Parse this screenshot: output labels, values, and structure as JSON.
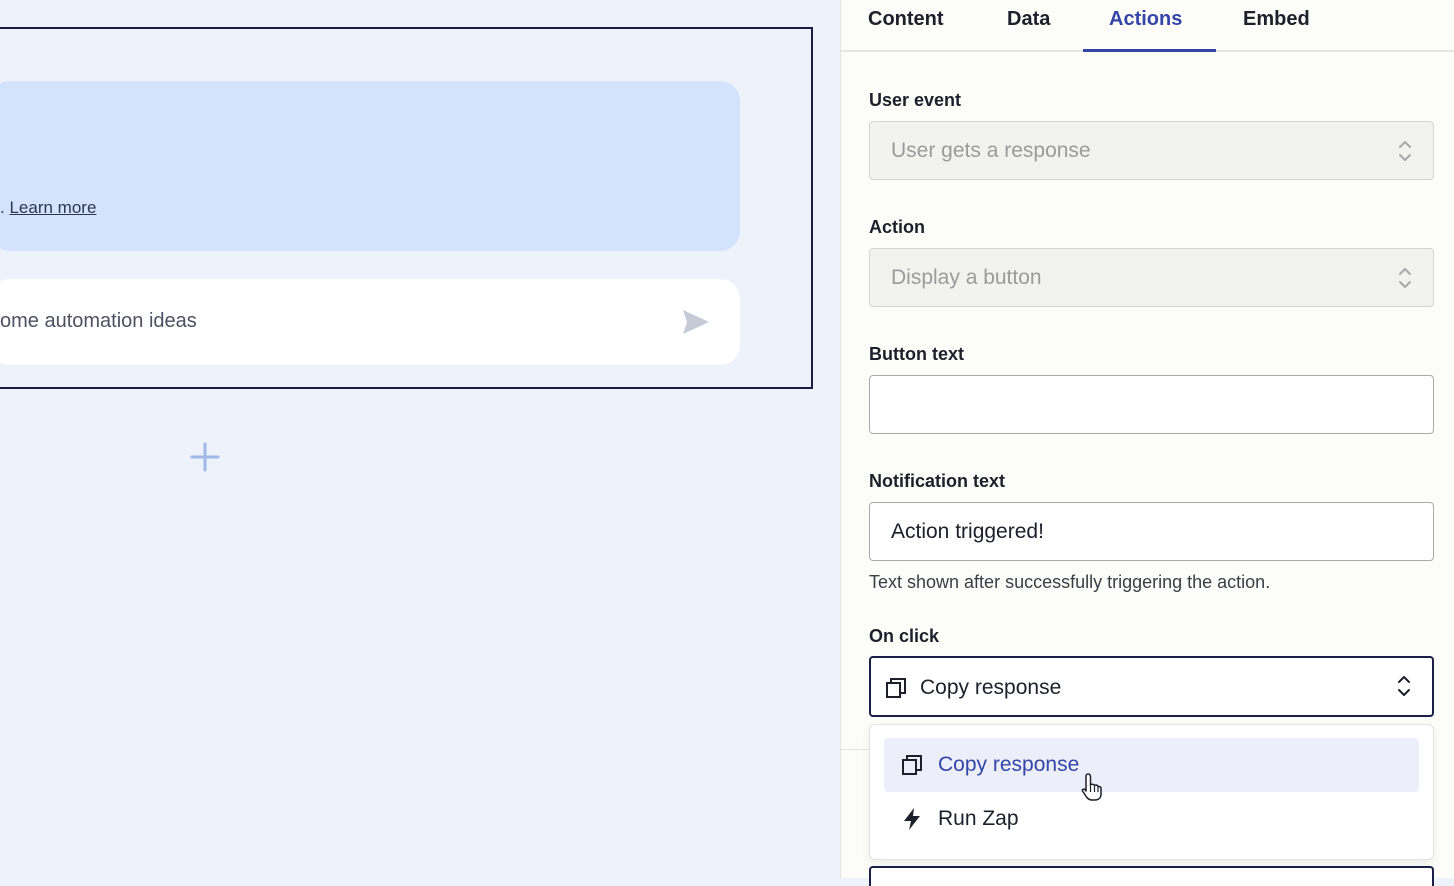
{
  "canvas": {
    "message_text_partial": ".",
    "learn_more_link": "Learn more",
    "input_text_partial": "ome automation ideas"
  },
  "panel": {
    "tabs": [
      {
        "label": "Content",
        "active": false
      },
      {
        "label": "Data",
        "active": false
      },
      {
        "label": "Actions",
        "active": true
      },
      {
        "label": "Embed",
        "active": false
      }
    ],
    "user_event": {
      "label": "User event",
      "value": "User gets a response"
    },
    "action": {
      "label": "Action",
      "value": "Display a button"
    },
    "button_text": {
      "label": "Button text",
      "value": ""
    },
    "notification_text": {
      "label": "Notification text",
      "value": "Action triggered!",
      "help": "Text shown after successfully triggering the action."
    },
    "on_click": {
      "label": "On click",
      "value": "Copy response",
      "options": [
        {
          "label": "Copy response",
          "icon": "copy-icon",
          "highlighted": true
        },
        {
          "label": "Run Zap",
          "icon": "lightning-icon",
          "highlighted": false
        }
      ]
    }
  },
  "colors": {
    "accent": "#3545a8",
    "canvas_bg": "#eef2fb",
    "bubble_bg": "#d3e3fb",
    "frame_border": "#1c1e4a"
  }
}
